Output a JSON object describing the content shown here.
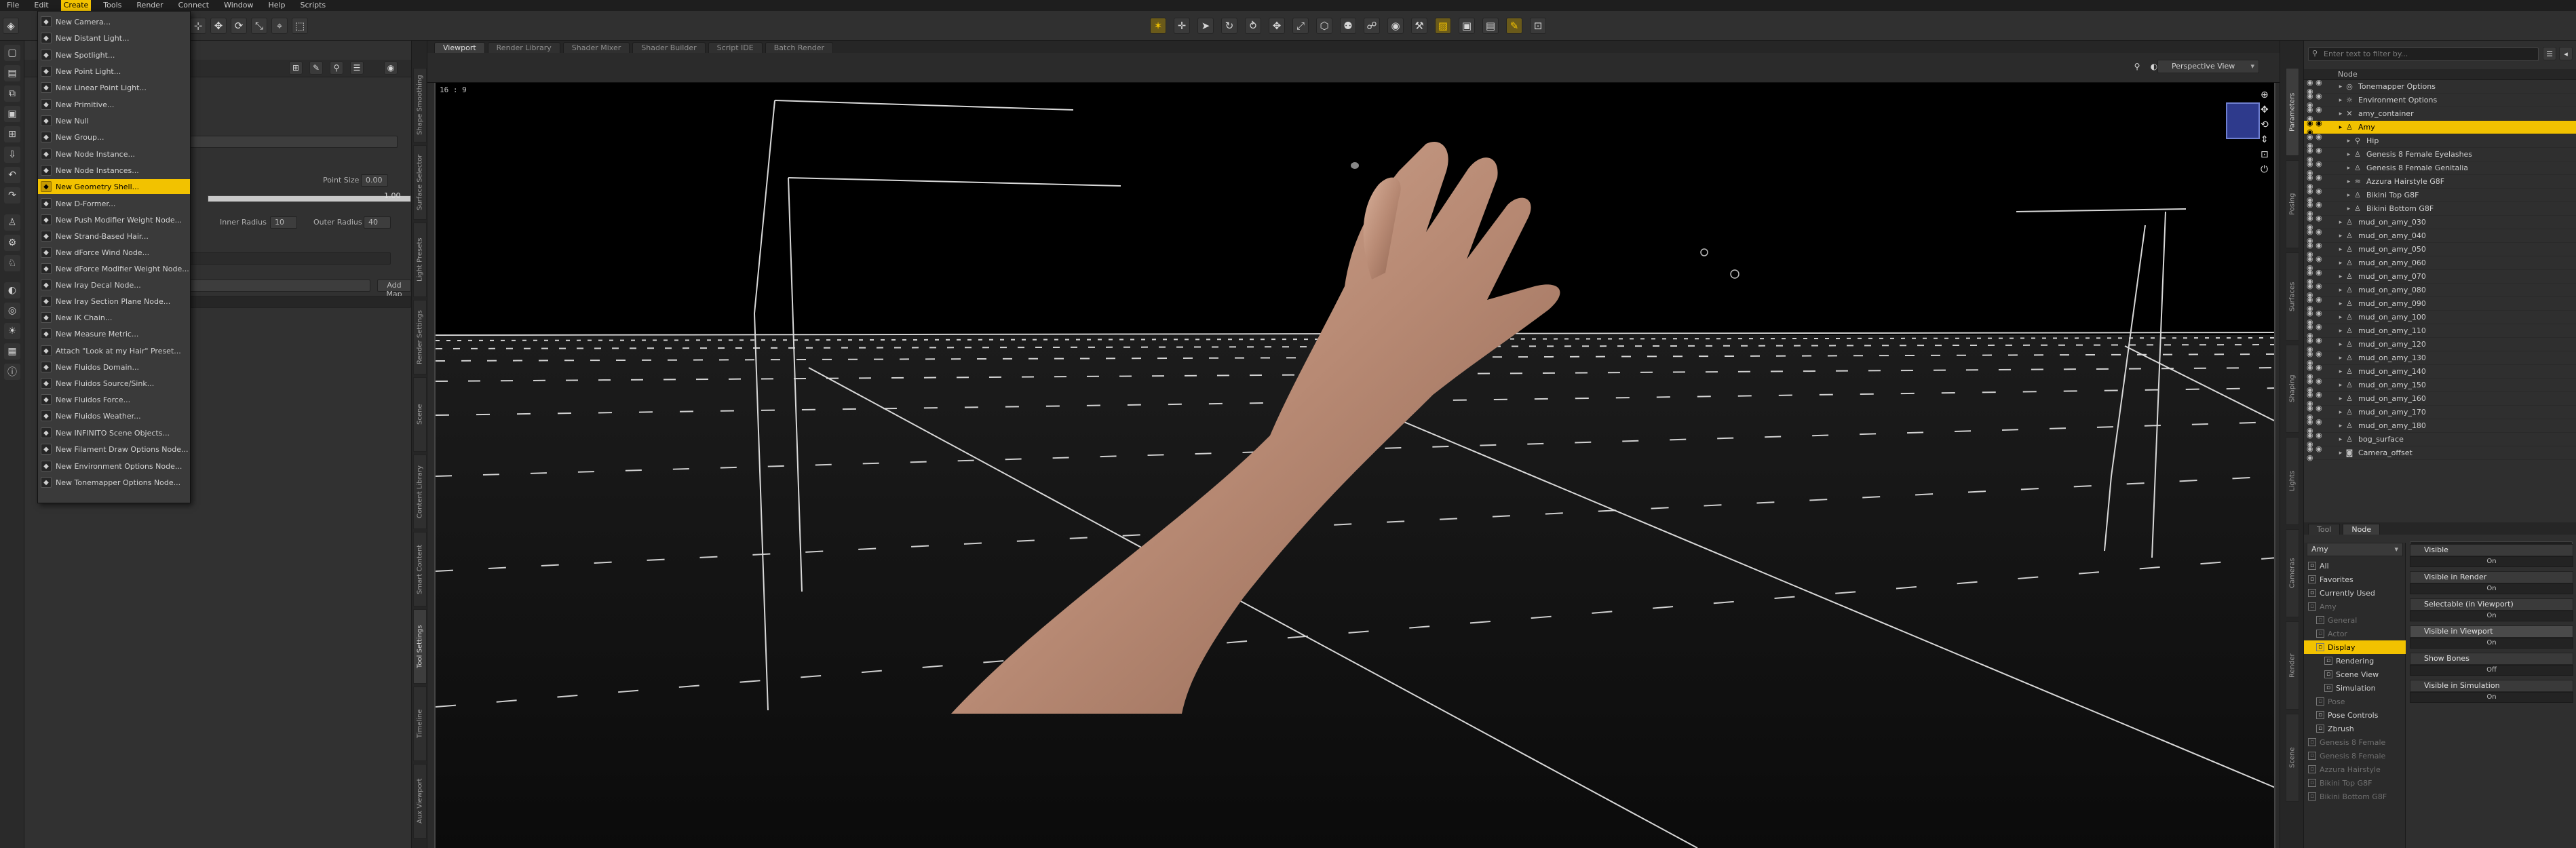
{
  "menubar": {
    "items": [
      "File",
      "Edit",
      "Create",
      "Tools",
      "Render",
      "Connect",
      "Window",
      "Help",
      "Scripts"
    ],
    "active_index": 2
  },
  "create_menu": {
    "items": [
      {
        "label": "New Camera...",
        "icon": "camera-icon"
      },
      {
        "label": "New Distant Light...",
        "icon": "distant-light-icon"
      },
      {
        "label": "New Spotlight...",
        "icon": "spotlight-icon"
      },
      {
        "label": "New Point Light...",
        "icon": "point-light-icon"
      },
      {
        "label": "New Linear Point Light...",
        "icon": "linear-light-icon"
      },
      {
        "label": "New Primitive...",
        "icon": "primitive-icon"
      },
      {
        "label": "New Null",
        "icon": "null-icon"
      },
      {
        "label": "New Group...",
        "icon": "group-icon"
      },
      {
        "label": "New Node Instance...",
        "icon": "instance-icon"
      },
      {
        "label": "New Node Instances...",
        "icon": "instances-icon"
      },
      {
        "label": "New Geometry Shell...",
        "icon": "geometry-shell-icon"
      },
      {
        "label": "New D-Former...",
        "icon": "dformer-icon"
      },
      {
        "label": "New Push Modifier Weight Node...",
        "icon": "push-modifier-icon"
      },
      {
        "label": "New Strand-Based Hair...",
        "icon": "hair-icon"
      },
      {
        "label": "New dForce Wind Node...",
        "icon": "wind-icon"
      },
      {
        "label": "New dForce Modifier Weight Node...",
        "icon": "dforce-weight-icon"
      },
      {
        "label": "New Iray Decal Node...",
        "icon": "decal-icon"
      },
      {
        "label": "New Iray Section Plane Node...",
        "icon": "section-plane-icon"
      },
      {
        "label": "New IK Chain...",
        "icon": "ik-chain-icon"
      },
      {
        "label": "New Measure Metric...",
        "icon": "measure-icon"
      },
      {
        "label": "Attach \"Look at my Hair\" Preset...",
        "icon": "look-at-hair-icon"
      },
      {
        "label": "New Fluidos Domain...",
        "icon": "fluidos-domain-icon"
      },
      {
        "label": "New Fluidos Source/Sink...",
        "icon": "fluidos-source-icon"
      },
      {
        "label": "New Fluidos Force...",
        "icon": "fluidos-force-icon"
      },
      {
        "label": "New Fluidos Weather...",
        "icon": "fluidos-weather-icon"
      },
      {
        "label": "New INFINITO Scene Objects...",
        "icon": "infinito-icon"
      },
      {
        "label": "New Filament Draw Options Node...",
        "icon": "filament-icon"
      },
      {
        "label": "New Environment Options Node...",
        "icon": "environment-icon"
      },
      {
        "label": "New Tonemapper Options Node...",
        "icon": "tonemapper-icon"
      }
    ],
    "highlight_index": 10,
    "separators_after": [
      1,
      4,
      7,
      10,
      19,
      24,
      26
    ]
  },
  "left_panel": {
    "point_size_label": "Point Size",
    "point_size_value": "0.00",
    "bar_value": "1.00",
    "inner_radius_label": "Inner Radius",
    "inner_radius_value": "10",
    "outer_radius_label": "Outer Radius",
    "outer_radius_value": "40",
    "add_map_label": "Add Map",
    "bar_fill": 1.0
  },
  "left_vtabs": [
    "Shape Smoothing",
    "Surface Selector",
    "Light Presets",
    "Render Settings",
    "Scene",
    "Content Library",
    "Smart Content",
    "Tool Settings",
    "Timeline",
    "Aux Viewport"
  ],
  "viewport": {
    "tabs": [
      "Viewport",
      "Render Library",
      "Shader Mixer",
      "Shader Builder",
      "Script IDE",
      "Batch Render"
    ],
    "active_tab": 0,
    "aspect_label": "16 : 9",
    "view_select": "Perspective View"
  },
  "right_vtabs": [
    "Parameters",
    "Posing",
    "Surfaces",
    "Shaping",
    "Lights",
    "Cameras",
    "Render",
    "Scene"
  ],
  "scene": {
    "search_placeholder": "Enter text to filter by...",
    "header": "Node",
    "rows": [
      {
        "name": "Tonemapper Options",
        "indent": 1,
        "icon": "tonemapper-icon"
      },
      {
        "name": "Environment Options",
        "indent": 1,
        "icon": "environment-icon"
      },
      {
        "name": "amy_container",
        "indent": 1,
        "icon": "null-icon"
      },
      {
        "name": "Amy",
        "indent": 1,
        "icon": "figure-icon",
        "selected": true
      },
      {
        "name": "Hip",
        "indent": 2,
        "icon": "bone-icon"
      },
      {
        "name": "Genesis 8 Female Eyelashes",
        "indent": 2,
        "icon": "figure-icon"
      },
      {
        "name": "Genesis 8 Female Genitalia",
        "indent": 2,
        "icon": "figure-icon"
      },
      {
        "name": "Azzura Hairstyle G8F",
        "indent": 2,
        "icon": "hair-icon"
      },
      {
        "name": "Bikini Top G8F",
        "indent": 2,
        "icon": "clothing-icon"
      },
      {
        "name": "Bikini Bottom G8F",
        "indent": 2,
        "icon": "clothing-icon"
      },
      {
        "name": "mud_on_amy_030",
        "indent": 1,
        "icon": "figure-icon"
      },
      {
        "name": "mud_on_amy_040",
        "indent": 1,
        "icon": "figure-icon"
      },
      {
        "name": "mud_on_amy_050",
        "indent": 1,
        "icon": "figure-icon"
      },
      {
        "name": "mud_on_amy_060",
        "indent": 1,
        "icon": "figure-icon"
      },
      {
        "name": "mud_on_amy_070",
        "indent": 1,
        "icon": "figure-icon"
      },
      {
        "name": "mud_on_amy_080",
        "indent": 1,
        "icon": "figure-icon"
      },
      {
        "name": "mud_on_amy_090",
        "indent": 1,
        "icon": "figure-icon"
      },
      {
        "name": "mud_on_amy_100",
        "indent": 1,
        "icon": "figure-icon"
      },
      {
        "name": "mud_on_amy_110",
        "indent": 1,
        "icon": "figure-icon"
      },
      {
        "name": "mud_on_amy_120",
        "indent": 1,
        "icon": "figure-icon"
      },
      {
        "name": "mud_on_amy_130",
        "indent": 1,
        "icon": "figure-icon"
      },
      {
        "name": "mud_on_amy_140",
        "indent": 1,
        "icon": "figure-icon"
      },
      {
        "name": "mud_on_amy_150",
        "indent": 1,
        "icon": "figure-icon"
      },
      {
        "name": "mud_on_amy_160",
        "indent": 1,
        "icon": "figure-icon"
      },
      {
        "name": "mud_on_amy_170",
        "indent": 1,
        "icon": "figure-icon"
      },
      {
        "name": "mud_on_amy_180",
        "indent": 1,
        "icon": "figure-icon"
      },
      {
        "name": "bog_surface",
        "indent": 1,
        "icon": "figure-icon"
      },
      {
        "name": "Camera_offset",
        "indent": 1,
        "icon": "camera-icon"
      }
    ]
  },
  "params": {
    "tabs": [
      "Tool",
      "Node"
    ],
    "active_tab": 1,
    "search_placeholder": "Enter text to filter by...",
    "node_select": "Amy",
    "groups": [
      {
        "label": "All",
        "indent": 0
      },
      {
        "label": "Favorites",
        "indent": 0
      },
      {
        "label": "Currently Used",
        "indent": 0
      },
      {
        "label": "Amy",
        "indent": 0,
        "dim": true
      },
      {
        "label": "General",
        "indent": 1,
        "dim": true
      },
      {
        "label": "Actor",
        "indent": 1,
        "dim": true
      },
      {
        "label": "Display",
        "indent": 1,
        "highlight": true
      },
      {
        "label": "Rendering",
        "indent": 2
      },
      {
        "label": "Scene View",
        "indent": 2
      },
      {
        "label": "Simulation",
        "indent": 2
      },
      {
        "label": "Pose",
        "indent": 1,
        "dim": true
      },
      {
        "label": "Pose Controls",
        "indent": 1
      },
      {
        "label": "Zbrush",
        "indent": 1
      },
      {
        "label": "Genesis 8 Female",
        "indent": 0,
        "dim": true
      },
      {
        "label": "Genesis 8 Female",
        "indent": 0,
        "dim": true
      },
      {
        "label": "Azzura Hairstyle",
        "indent": 0,
        "dim": true
      },
      {
        "label": "Bikini Top G8F",
        "indent": 0,
        "dim": true
      },
      {
        "label": "Bikini Bottom G8F",
        "indent": 0,
        "dim": true
      }
    ],
    "properties": [
      {
        "label": "Visible",
        "value": "On"
      },
      {
        "label": "Visible in Render",
        "value": "On"
      },
      {
        "label": "Selectable (in Viewport)",
        "value": "On"
      },
      {
        "label": "Visible in Viewport",
        "value": "On",
        "highlight": true
      },
      {
        "label": "Show Bones",
        "value": "Off"
      },
      {
        "label": "Visible in Simulation",
        "value": "On"
      }
    ]
  },
  "colors": {
    "accent": "#f2c200",
    "panel": "#2f2f2f",
    "viewport_bg": "#000000"
  }
}
